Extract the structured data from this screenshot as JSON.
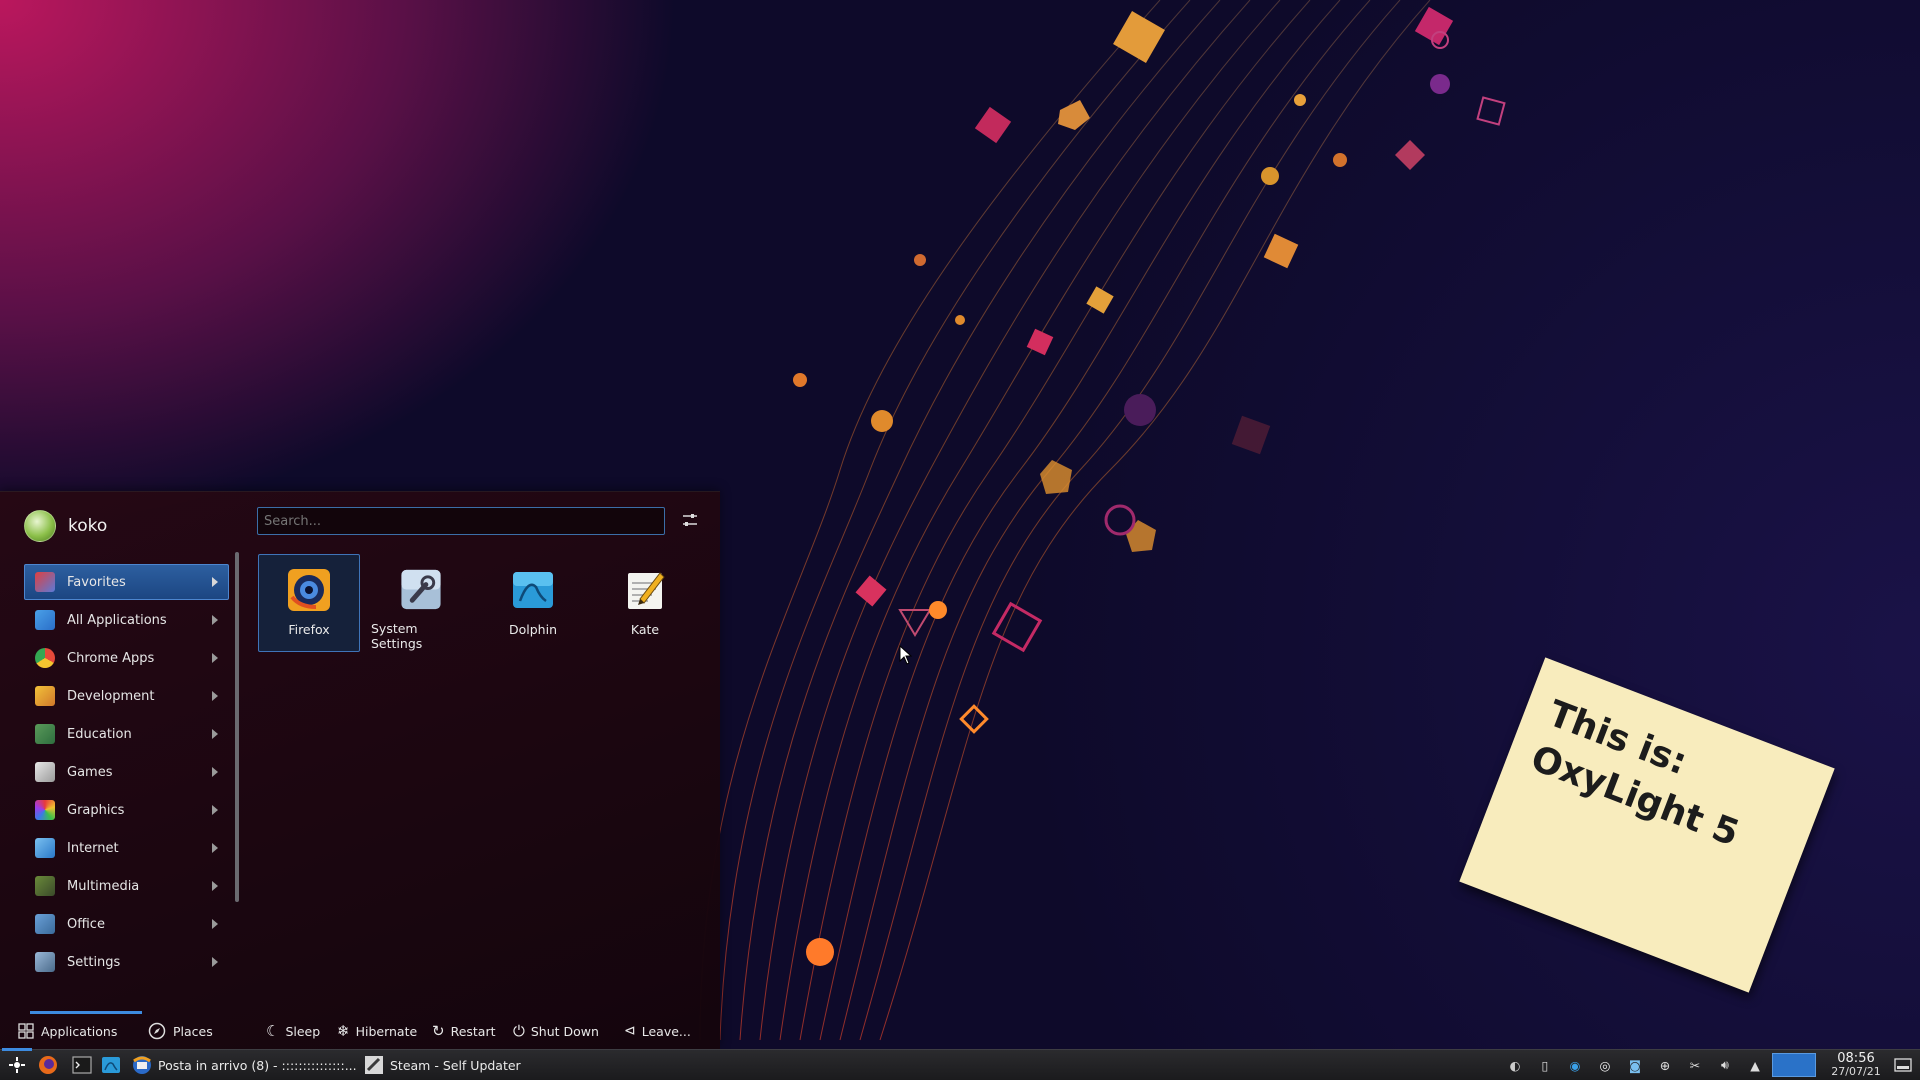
{
  "launcher": {
    "username": "koko",
    "search_placeholder": "Search...",
    "categories": [
      {
        "label": "Favorites",
        "icon": "favorites-icon",
        "active": true
      },
      {
        "label": "All Applications",
        "icon": "all-applications-icon"
      },
      {
        "label": "Chrome Apps",
        "icon": "chrome-icon"
      },
      {
        "label": "Development",
        "icon": "development-icon"
      },
      {
        "label": "Education",
        "icon": "education-icon"
      },
      {
        "label": "Games",
        "icon": "games-icon"
      },
      {
        "label": "Graphics",
        "icon": "graphics-icon"
      },
      {
        "label": "Internet",
        "icon": "internet-icon"
      },
      {
        "label": "Multimedia",
        "icon": "multimedia-icon"
      },
      {
        "label": "Office",
        "icon": "office-icon"
      },
      {
        "label": "Settings",
        "icon": "settings-icon"
      }
    ],
    "favorites": [
      {
        "label": "Firefox",
        "icon": "firefox-icon",
        "active": true
      },
      {
        "label": "System Settings",
        "icon": "system-settings-icon"
      },
      {
        "label": "Dolphin",
        "icon": "dolphin-icon"
      },
      {
        "label": "Kate",
        "icon": "kate-icon"
      }
    ],
    "tabs": {
      "applications": "Applications",
      "places": "Places"
    },
    "power": {
      "sleep": "Sleep",
      "hibernate": "Hibernate",
      "restart": "Restart",
      "shutdown": "Shut Down",
      "leave": "Leave..."
    }
  },
  "note": {
    "line1": "This is:",
    "line2": "OxyLight 5"
  },
  "taskbar": {
    "tasks": [
      {
        "label": "Posta in arrivo (8) - :::::::::::::::...",
        "icon": "thunderbird-icon"
      },
      {
        "label": "Steam - Self Updater",
        "icon": "steam-icon"
      }
    ],
    "clock": {
      "time": "08:56",
      "date": "27/07/21"
    }
  },
  "colors": {
    "accent": "#3d8be0",
    "active_category": "#2d5fa0",
    "note": "#f8ecbd"
  }
}
